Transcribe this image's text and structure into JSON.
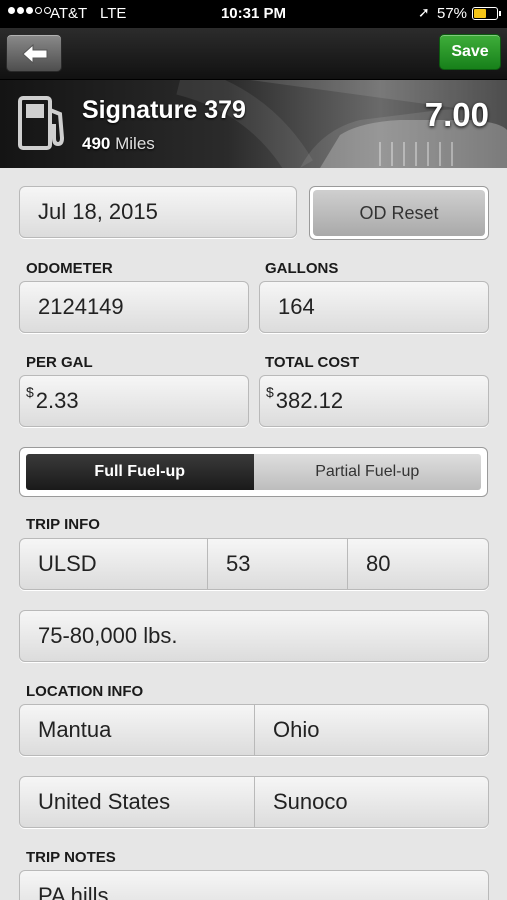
{
  "status_bar": {
    "carrier": "AT&T",
    "network": "LTE",
    "time": "10:31 PM",
    "battery_percent": "57%",
    "battery_level": 0.57,
    "signal_dots_filled": 3,
    "signal_dots_total": 5
  },
  "nav": {
    "back_icon": "back-arrow-icon",
    "save_label": "Save"
  },
  "header": {
    "icon": "fuel-pump-icon",
    "truck_name": "Signature 379",
    "miles_value": "490",
    "miles_unit": "Miles",
    "mpg": "7.00"
  },
  "form": {
    "date": "Jul 18, 2015",
    "od_reset_label": "OD Reset",
    "odometer_label": "ODOMETER",
    "odometer_value": "2124149",
    "gallons_label": "GALLONS",
    "gallons_value": "164",
    "per_gal_label": "PER GAL",
    "per_gal_currency": "$",
    "per_gal_value": "2.33",
    "total_cost_label": "TOTAL COST",
    "total_cost_currency": "$",
    "total_cost_value": "382.12",
    "fuelup_options": [
      "Full Fuel-up",
      "Partial Fuel-up"
    ],
    "fuelup_selected": "Full Fuel-up",
    "trip_info_label": "TRIP INFO",
    "fuel_type": "ULSD",
    "trip_value_1": "53",
    "trip_value_2": "80",
    "weight": "75-80,000 lbs.",
    "location_info_label": "LOCATION INFO",
    "city": "Mantua",
    "state": "Ohio",
    "country": "United States",
    "station": "Sunoco",
    "trip_notes_label": "TRIP NOTES",
    "trip_notes": "PA hills"
  }
}
